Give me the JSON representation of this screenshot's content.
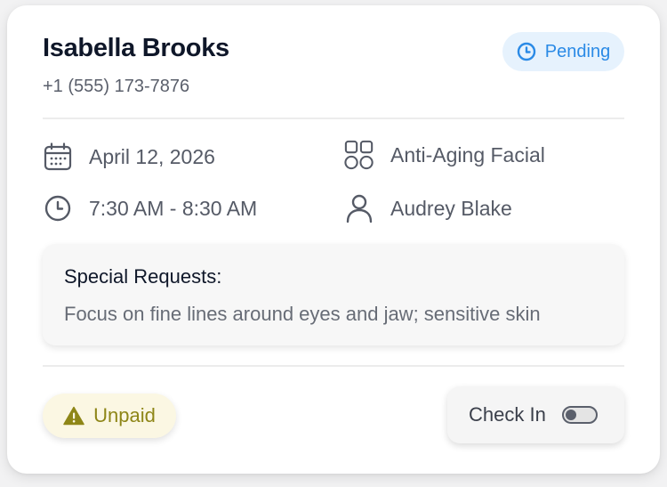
{
  "client": {
    "name": "Isabella Brooks",
    "phone": "+1 (555) 173-7876"
  },
  "status": {
    "label": "Pending",
    "icon": "clock-icon",
    "color": "#2a8ae6"
  },
  "appointment": {
    "date": "April 12, 2026",
    "time": "7:30 AM - 8:30 AM",
    "service": "Anti-Aging Facial",
    "staff": "Audrey Blake"
  },
  "requests": {
    "title": "Special Requests:",
    "text": "Focus on fine lines around eyes and jaw; sensitive skin"
  },
  "payment": {
    "label": "Unpaid",
    "icon": "warning-icon",
    "color": "#8e8617"
  },
  "checkin": {
    "label": "Check In",
    "enabled": false
  }
}
